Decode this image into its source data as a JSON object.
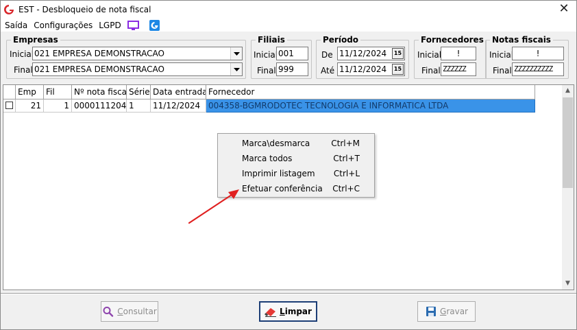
{
  "window": {
    "title": "EST - Desbloqueio de nota fiscal",
    "close_glyph": "✕"
  },
  "menu": {
    "items": [
      "Saída",
      "Configurações",
      "LGPD"
    ],
    "icons": [
      "monitor-icon",
      "app-g-icon"
    ]
  },
  "filters": {
    "empresas": {
      "legend": "Empresas",
      "inicial_label": "Inicial",
      "inicial_value": "021 EMPRESA DEMONSTRACAO",
      "final_label": "Final",
      "final_value": "021 EMPRESA DEMONSTRACAO"
    },
    "filiais": {
      "legend": "Filiais",
      "inicial_label": "Inicial",
      "inicial_value": "001",
      "final_label": "Final",
      "final_value": "999"
    },
    "periodo": {
      "legend": "Período",
      "de_label": "De",
      "de_value": "11/12/2024",
      "ate_label": "Até",
      "ate_value": "11/12/2024",
      "calendar_glyph": "15"
    },
    "fornecedores": {
      "legend": "Fornecedores",
      "inicial_label": "Inicial",
      "inicial_value": "!",
      "final_label": "Final",
      "final_value": "ZZZZZZ"
    },
    "notas": {
      "legend": "Notas fiscais",
      "inicial_label": "Inicial",
      "inicial_value": "!",
      "final_label": "Final",
      "final_value": "ZZZZZZZZZZ"
    }
  },
  "grid": {
    "columns": [
      "",
      "Emp",
      "Fil",
      "Nº nota fiscal",
      "Série",
      "Data entrada",
      "Fornecedor"
    ],
    "rows": [
      {
        "checked": false,
        "emp": "21",
        "fil": "1",
        "nota": "0000111204",
        "serie": "1",
        "data": "11/12/2024",
        "fornecedor": "004358-BGMRODOTEC TECNOLOGIA E INFORMATICA LTDA"
      }
    ]
  },
  "context_menu": {
    "items": [
      {
        "label": "Marca\\desmarca",
        "shortcut": "Ctrl+M"
      },
      {
        "label": "Marca todos",
        "shortcut": "Ctrl+T"
      },
      {
        "label": "Imprimir listagem",
        "shortcut": "Ctrl+L"
      },
      {
        "label": "Efetuar conferência",
        "shortcut": "Ctrl+C"
      }
    ]
  },
  "buttons": {
    "consultar": {
      "first": "C",
      "rest": "onsultar",
      "enabled": false
    },
    "limpar": {
      "first": "L",
      "rest": "impar",
      "enabled": true
    },
    "gravar": {
      "first": "G",
      "rest": "ravar",
      "enabled": false
    }
  },
  "colors": {
    "selection": "#3a93e8",
    "arrow": "#e02020",
    "logo": "#d9262b"
  }
}
